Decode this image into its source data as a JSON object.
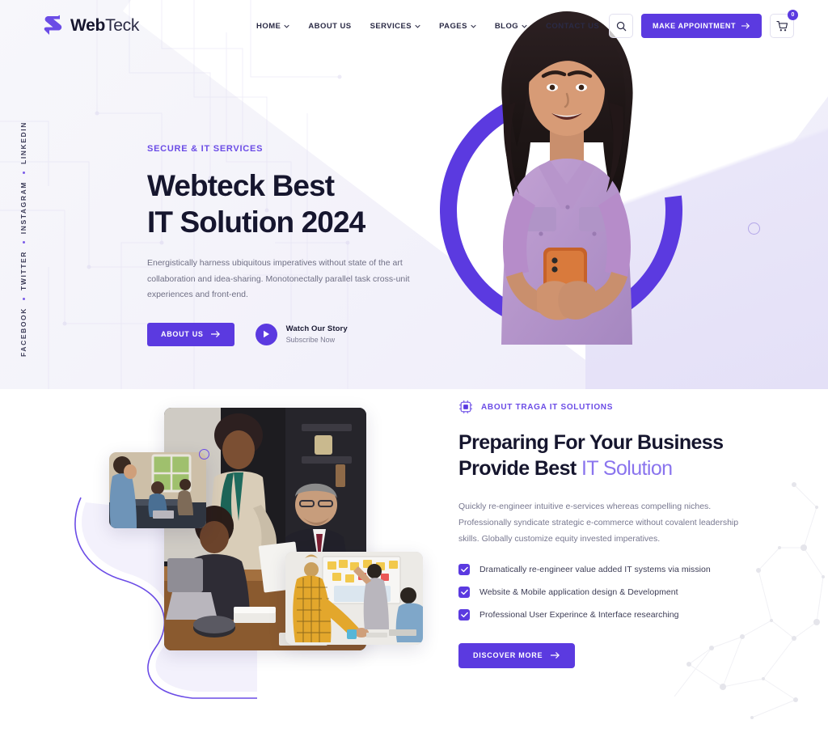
{
  "brand": {
    "name_bold": "Web",
    "name_light": "Teck",
    "logo_icon": "webteck-s-logo"
  },
  "nav": {
    "items": [
      {
        "label": "HOME",
        "has_dropdown": true
      },
      {
        "label": "ABOUT US",
        "has_dropdown": false
      },
      {
        "label": "SERVICES",
        "has_dropdown": true
      },
      {
        "label": "PAGES",
        "has_dropdown": true
      },
      {
        "label": "BLOG",
        "has_dropdown": true
      },
      {
        "label": "CONTACT US",
        "has_dropdown": false
      }
    ]
  },
  "header_actions": {
    "search_icon": "search-icon",
    "appointment_label": "MAKE APPOINTMENT",
    "cart_icon": "shopping-cart-icon",
    "cart_count": "0"
  },
  "social_rail": {
    "items": [
      {
        "label": "FACEBOOK"
      },
      {
        "label": "TWITTER"
      },
      {
        "label": "INSTAGRAM"
      },
      {
        "label": "LINKEDIN"
      }
    ]
  },
  "hero": {
    "eyebrow": "SECURE & IT SERVICES",
    "title_line1": "Webteck Best",
    "title_line2": "IT Solution 2024",
    "description": "Energistically harness ubiquitous imperatives without state of the art collaboration and idea-sharing. Monotonectally parallel task cross-unit experiences and front-end.",
    "primary_button": "ABOUT US",
    "watch_title": "Watch Our Story",
    "watch_subtitle": "Subscribe Now",
    "play_icon": "play-icon"
  },
  "about": {
    "eyebrow": "ABOUT TRAGA IT SOLUTIONS",
    "eyebrow_icon": "chip-icon",
    "title_line1": "Preparing For Your Business",
    "title_line2_dark": "Provide Best ",
    "title_line2_accent": "IT Solution",
    "description": "Quickly re-engineer intuitive e-services whereas compelling niches. Professionally syndicate strategic e-commerce without covalent leadership skills. Globally customize equity invested imperatives.",
    "checklist": [
      "Dramatically re-engineer value added IT systems via mission",
      "Website & Mobile application design & Development",
      "Professional User Experince & Interface researching"
    ],
    "cta_label": "DISCOVER MORE"
  },
  "colors": {
    "brand_purple": "#5b3ae0",
    "accent_light_purple": "#8a74ee",
    "eyebrow_purple": "#6b4ce6",
    "heading_dark": "#16162e",
    "body_gray": "#787890",
    "hero_bg_start": "#f7f7fb",
    "hero_bg_end": "#eeecfa"
  }
}
